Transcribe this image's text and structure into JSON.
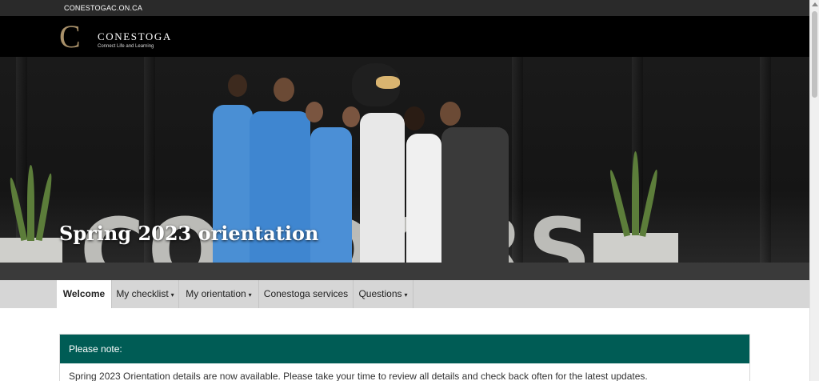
{
  "topbar": {
    "site_link": "CONESTOGAC.ON.CA"
  },
  "brand": {
    "mark": "C",
    "name": "CONESTOGA",
    "tagline": "Connect Life and Learning"
  },
  "hero": {
    "title": "Spring 2023 orientation",
    "backdrop_letters": "CONDORS"
  },
  "nav": {
    "items": [
      {
        "label": "Welcome",
        "dropdown": false,
        "active": true
      },
      {
        "label": "My checklist",
        "dropdown": true,
        "active": false
      },
      {
        "label": "My orientation",
        "dropdown": true,
        "active": false
      },
      {
        "label": "Conestoga services",
        "dropdown": false,
        "active": false
      },
      {
        "label": "Questions",
        "dropdown": true,
        "active": false
      }
    ],
    "caret": "▾"
  },
  "notice": {
    "heading": "Please note:",
    "body": "Spring 2023 Orientation details are now available. Please take your time to review all details and check back often for the latest updates."
  },
  "colors": {
    "notice_header": "#005c55",
    "brand_gold": "#a9916a",
    "nav_bg": "#d6d6d6"
  }
}
